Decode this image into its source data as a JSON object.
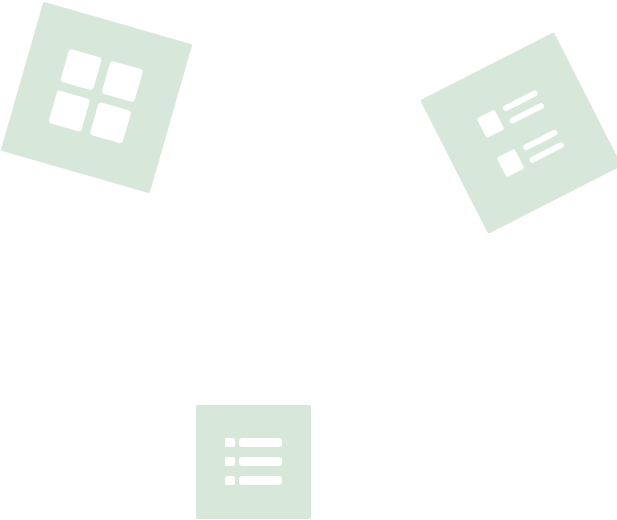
{
  "colors": {
    "background": "#ffffff",
    "tile": "#d7e7d9",
    "glyph": "#ffffff"
  },
  "tiles": [
    {
      "name": "grid-view",
      "icon": "grid-icon"
    },
    {
      "name": "details-view",
      "icon": "details-list-icon"
    },
    {
      "name": "list-view",
      "icon": "list-icon"
    }
  ]
}
